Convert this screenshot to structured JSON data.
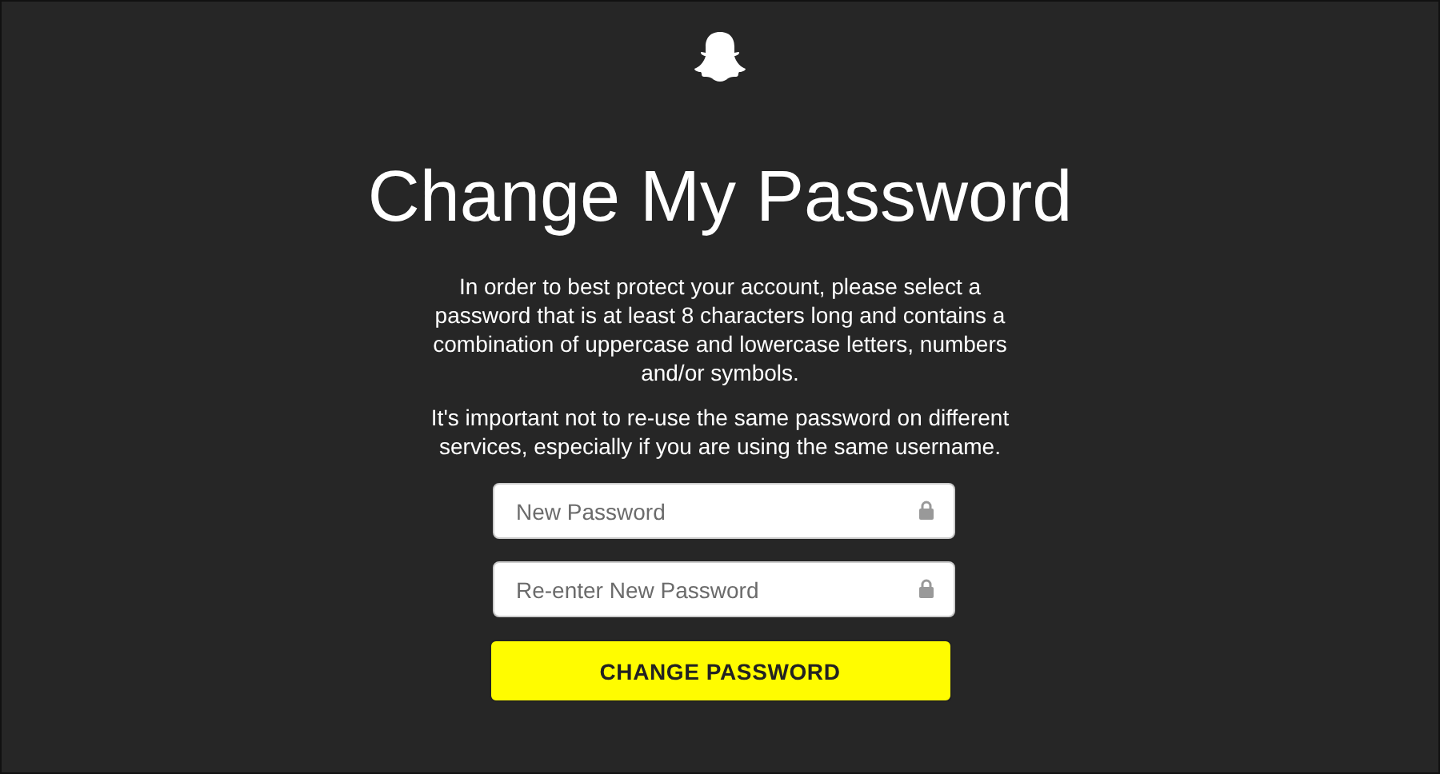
{
  "title": "Change My Password",
  "paragraphs": [
    "In order to best protect your account, please select a password that is at least 8 characters long and contains a combination of uppercase and lowercase letters, numbers and/or symbols.",
    "It's important not to re-use the same password on different services, especially if you are using the same username."
  ],
  "fields": [
    {
      "placeholder": "New Password"
    },
    {
      "placeholder": "Re-enter New Password"
    }
  ],
  "button": "CHANGE PASSWORD"
}
